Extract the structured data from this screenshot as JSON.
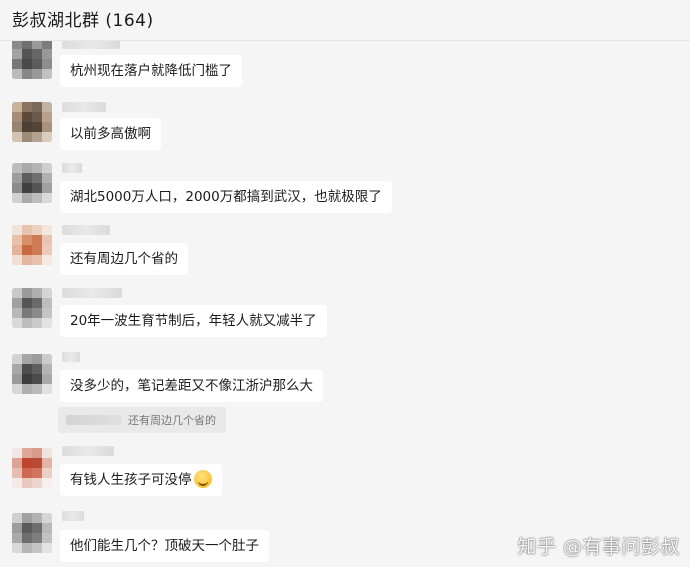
{
  "header": {
    "title": "彭叔湖北群 (164)"
  },
  "messages": [
    {
      "text": "杭州现在落户就降低门槛了"
    },
    {
      "text": "以前多高傲啊"
    },
    {
      "text": "湖北5000万人口，2000万都搞到武汉，也就极限了"
    },
    {
      "text": "还有周边几个省的"
    },
    {
      "text": "20年一波生育节制后，年轻人就又减半了"
    },
    {
      "text": "没多少的，笔记差距又不像江浙沪那么大",
      "quote": "还有周边几个省的"
    },
    {
      "text": "有钱人生孩子可没停",
      "emoji": "grinning-face-emoji"
    },
    {
      "text": "他们能生几个？顶破天一个肚子"
    }
  ],
  "watermark": "知乎 @有事问彭叔",
  "colors": {
    "background": "#f5f5f5",
    "bubble": "#ffffff",
    "text": "#1c1c1c"
  }
}
